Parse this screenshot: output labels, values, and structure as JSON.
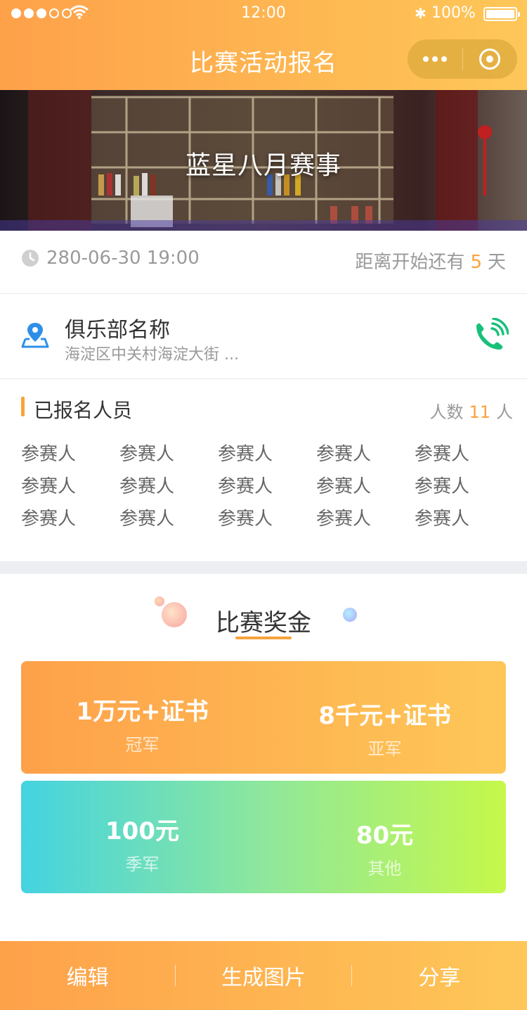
{
  "status_bar": {
    "time": "12:00",
    "battery": "100%",
    "bluetooth": "✱"
  },
  "nav": {
    "title": "比赛活动报名"
  },
  "banner": {
    "title": "蓝星八月赛事"
  },
  "event": {
    "datetime": "280-06-30  19:00",
    "countdown_prefix": "距离开始还有",
    "countdown_days": "5",
    "countdown_unit": "天"
  },
  "club": {
    "name": "俱乐部名称",
    "address": "海淀区中关村海淀大街 ..."
  },
  "signed_up": {
    "title": "已报名人员",
    "count_label": "人数",
    "count": "11",
    "count_unit": "人",
    "participants": [
      "参赛人",
      "参赛人",
      "参赛人",
      "参赛人",
      "参赛人",
      "参赛人",
      "参赛人",
      "参赛人",
      "参赛人",
      "参赛人",
      "参赛人",
      "参赛人",
      "参赛人",
      "参赛人",
      "参赛人"
    ]
  },
  "prizes": {
    "title": "比赛奖金",
    "items": [
      {
        "amount": "1万元+证书",
        "rank": "冠军"
      },
      {
        "amount": "8千元+证书",
        "rank": "亚军"
      },
      {
        "amount": "100元",
        "rank": "季军"
      },
      {
        "amount": "80元",
        "rank": "其他"
      }
    ]
  },
  "bottom_bar": {
    "edit": "编辑",
    "generate_image": "生成图片",
    "share": "分享"
  },
  "colors": {
    "accent": "#f9a23c",
    "header_start": "#fea14a",
    "header_end": "#fec758",
    "phone": "#18c07a",
    "map": "#2f8fe8"
  }
}
